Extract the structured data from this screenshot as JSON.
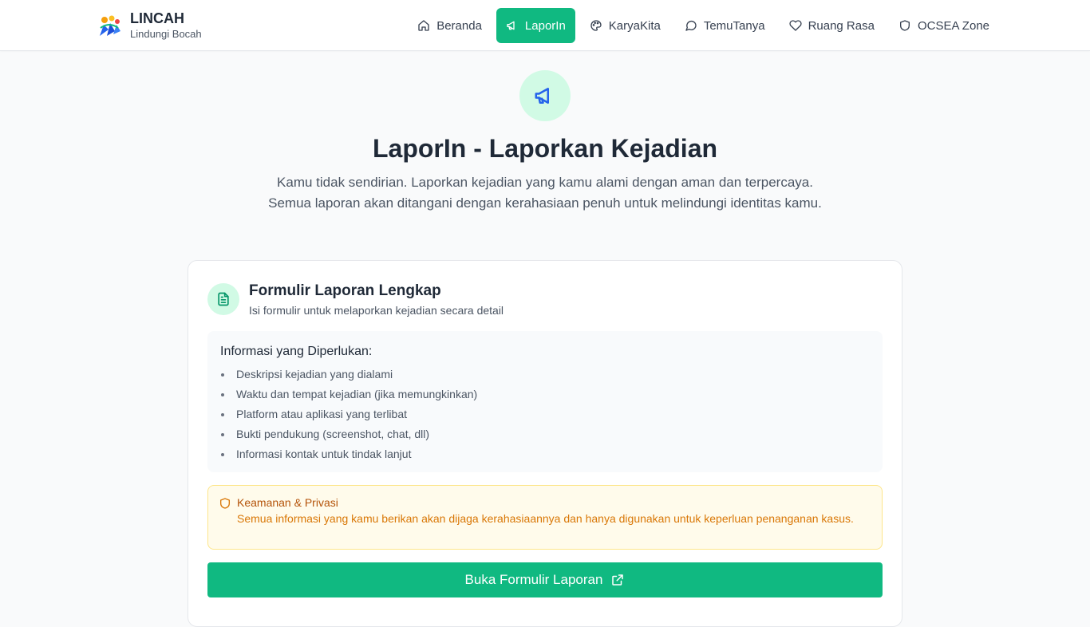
{
  "brand": {
    "name": "LINCAH",
    "tagline": "Lindungi Bocah"
  },
  "nav": {
    "items": [
      {
        "label": "Beranda",
        "icon": "home-icon"
      },
      {
        "label": "LaporIn",
        "icon": "megaphone-icon",
        "active": true
      },
      {
        "label": "KaryaKita",
        "icon": "palette-icon"
      },
      {
        "label": "TemuTanya",
        "icon": "chat-bubble-icon"
      },
      {
        "label": "Ruang Rasa",
        "icon": "heart-icon"
      },
      {
        "label": "OCSEA Zone",
        "icon": "shield-icon"
      }
    ]
  },
  "hero": {
    "icon": "megaphone-icon",
    "title": "LaporIn - Laporkan Kejadian",
    "subtitle": "Kamu tidak sendirian. Laporkan kejadian yang kamu alami dengan aman dan terpercaya. Semua laporan akan ditangani dengan kerahasiaan penuh untuk melindungi identitas kamu."
  },
  "form_card": {
    "icon": "document-icon",
    "title": "Formulir Laporan Lengkap",
    "subtitle": "Isi formulir untuk melaporkan kejadian secara detail",
    "info": {
      "title": "Informasi yang Diperlukan:",
      "items": [
        "Deskripsi kejadian yang dialami",
        "Waktu dan tempat kejadian (jika memungkinkan)",
        "Platform atau aplikasi yang terlibat",
        "Bukti pendukung (screenshot, chat, dll)",
        "Informasi kontak untuk tindak lanjut"
      ]
    },
    "security": {
      "icon": "shield-icon",
      "title": "Keamanan & Privasi",
      "text": "Semua informasi yang kamu berikan akan dijaga kerahasiaannya dan hanya digunakan untuk keperluan penanganan kasus."
    },
    "cta": {
      "label": "Buka Formulir Laporan",
      "icon": "external-link-icon"
    }
  },
  "colors": {
    "accent": "#10b981",
    "accent_soft": "#d1fae5",
    "warning_text": "#d97706",
    "warning_bg": "#fffbeb"
  }
}
